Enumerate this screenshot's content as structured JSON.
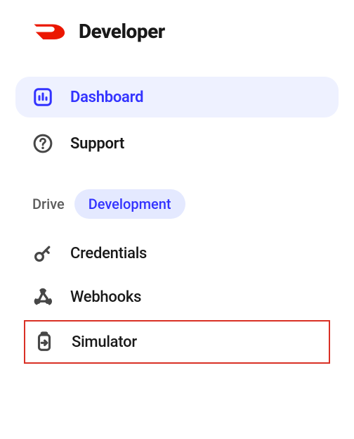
{
  "header": {
    "title": "Developer"
  },
  "nav": {
    "dashboard": "Dashboard",
    "support": "Support"
  },
  "section": {
    "label": "Drive",
    "env": "Development",
    "items": {
      "credentials": "Credentials",
      "webhooks": "Webhooks",
      "simulator": "Simulator"
    }
  },
  "colors": {
    "brand_red": "#eb1700",
    "active_blue": "#3333ff",
    "active_bg": "#eef1ff",
    "pill_bg": "#e4e9ff",
    "highlight_border": "#d93025"
  }
}
